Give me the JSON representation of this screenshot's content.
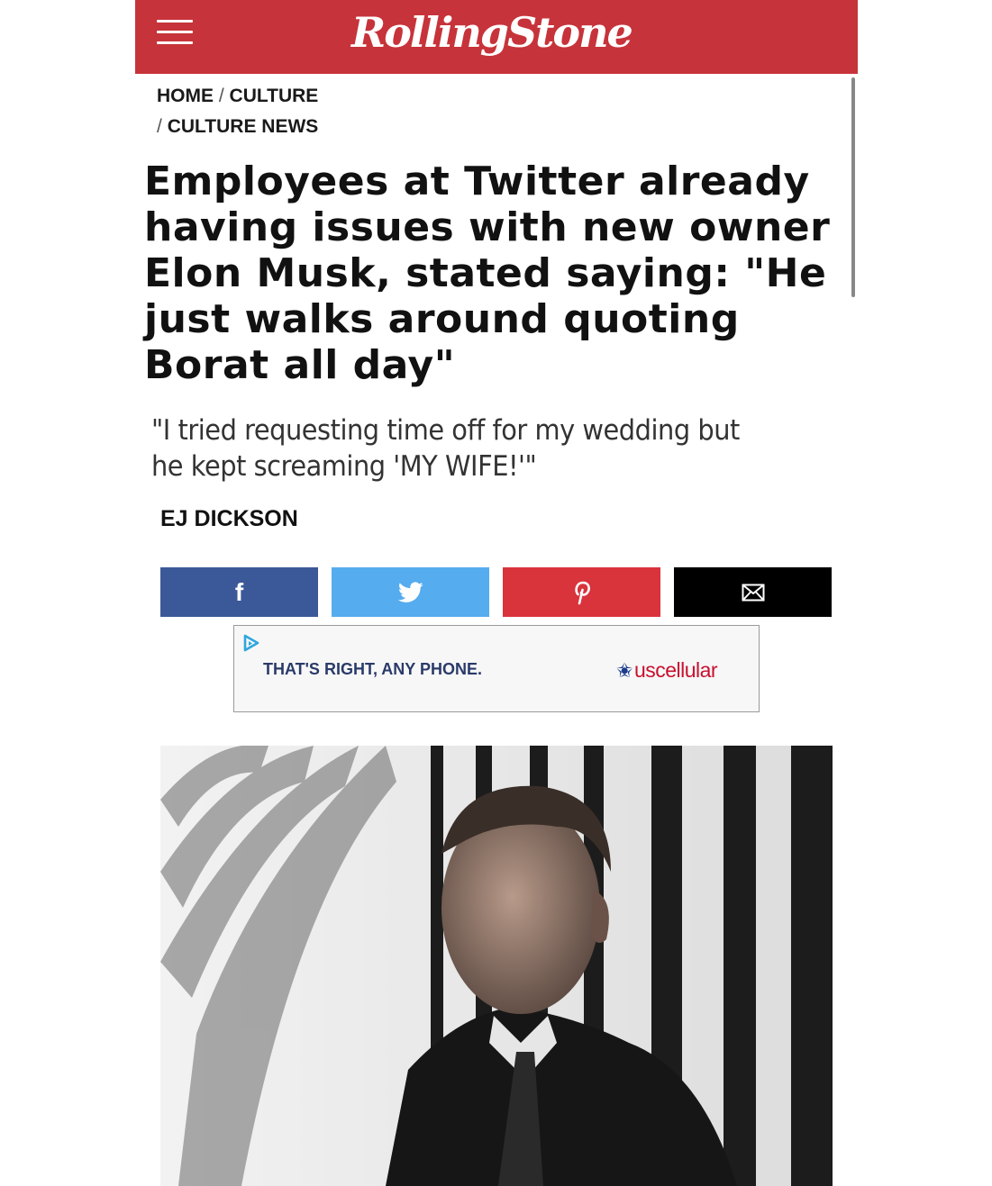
{
  "header": {
    "logo": "RollingStone",
    "menu_icon": "hamburger-menu-icon"
  },
  "breadcrumb": {
    "home": "HOME",
    "culture": "CULTURE",
    "culture_news": "CULTURE NEWS",
    "separator": "/"
  },
  "article": {
    "headline": "Employees at Twitter already having issues with new owner Elon Musk, stated saying: \"He just walks around quoting Borat all day\"",
    "dek": "\"I tried requesting time off for my wedding but he kept screaming 'MY WIFE!'\"",
    "byline": "EJ DICKSON"
  },
  "share": {
    "facebook_glyph": "f",
    "facebook_icon": "facebook-icon",
    "twitter_icon": "twitter-icon",
    "pinterest_icon": "pinterest-icon",
    "email_icon": "email-icon",
    "colors": {
      "facebook": "#3b5998",
      "twitter": "#55acee",
      "pinterest": "#d9333c",
      "email": "#000000"
    }
  },
  "ad": {
    "text": "THAT'S RIGHT, ANY PHONE.",
    "brand": "uscellular",
    "choices_icon": "adchoices-icon"
  },
  "colors": {
    "brand_red": "#c7333a"
  }
}
